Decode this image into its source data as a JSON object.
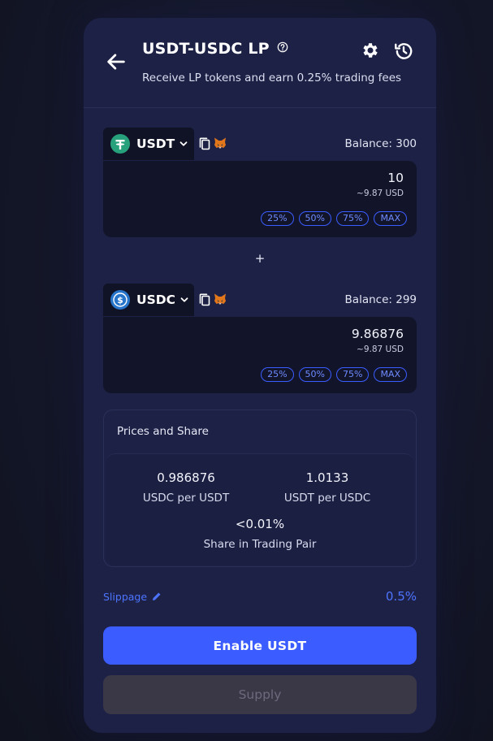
{
  "header": {
    "title": "USDT-USDC LP",
    "subtitle": "Receive LP tokens and earn 0.25% trading fees"
  },
  "icons": {
    "back": "arrow-left-icon",
    "help": "question-circle-icon",
    "settings": "gear-icon",
    "history": "history-icon",
    "copy": "copy-icon",
    "wallet": "metamask-fox-icon",
    "edit": "pencil-icon"
  },
  "token_a": {
    "symbol": "USDT",
    "balance": "Balance: 300",
    "amount": "10",
    "usd": "~9.87 USD",
    "logo_color": "#26a17b"
  },
  "plus": "+",
  "token_b": {
    "symbol": "USDC",
    "balance": "Balance: 299",
    "amount": "9.86876",
    "usd": "~9.87 USD",
    "logo_color": "#2775ca"
  },
  "percent_buttons": [
    "25%",
    "50%",
    "75%",
    "MAX"
  ],
  "prices": {
    "title": "Prices and Share",
    "rate_a": "0.986876",
    "rate_a_label": "USDC per USDT",
    "rate_b": "1.0133",
    "rate_b_label": "USDT per USDC",
    "share": "<0.01%",
    "share_label": "Share in Trading Pair"
  },
  "slippage": {
    "label": "Slippage",
    "value": "0.5%"
  },
  "buttons": {
    "enable": "Enable USDT",
    "supply": "Supply"
  },
  "colors": {
    "accent": "#3b5cff",
    "card": "#1d2146",
    "disabled": "#3a3747"
  }
}
